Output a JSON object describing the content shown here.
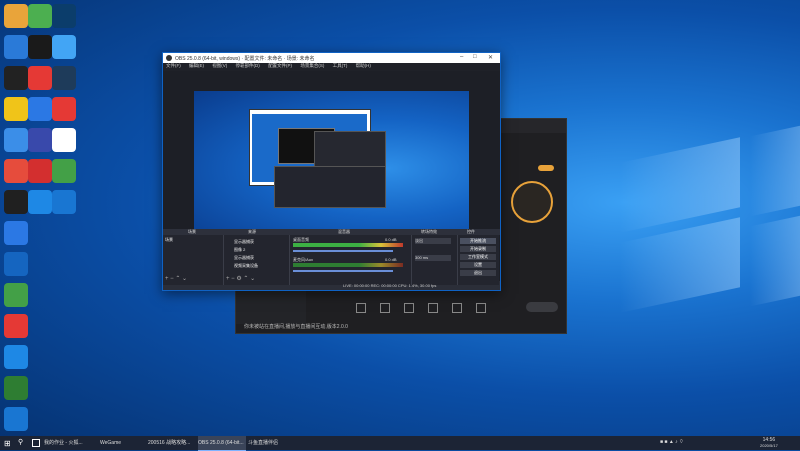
{
  "desktop": {
    "icons": [
      {
        "label": "",
        "color": "#e9a43a"
      },
      {
        "label": "",
        "color": "#2a7ad8"
      },
      {
        "label": "",
        "color": "#222"
      },
      {
        "label": "",
        "color": "#f0c419"
      },
      {
        "label": "",
        "color": "#3b8ee8"
      },
      {
        "label": "",
        "color": "#e64c3c"
      },
      {
        "label": "",
        "color": "#202020"
      },
      {
        "label": "",
        "color": "#4caf50"
      },
      {
        "label": "",
        "color": "#1a1a1a"
      },
      {
        "label": "",
        "color": "#e53935"
      },
      {
        "label": "",
        "color": "#2b78e4"
      },
      {
        "label": "",
        "color": "#3949ab"
      },
      {
        "label": "",
        "color": "#d32f2f"
      },
      {
        "label": "",
        "color": "#1e88e5"
      },
      {
        "label": "",
        "color": "#0b3d6b"
      },
      {
        "label": "",
        "color": "#42a5f5"
      },
      {
        "label": "",
        "color": "#1e3b5a"
      },
      {
        "label": "",
        "color": "#e53935"
      },
      {
        "label": "",
        "color": "#ffffff"
      },
      {
        "label": "",
        "color": "#43a047"
      },
      {
        "label": "",
        "color": "#1976d2"
      }
    ]
  },
  "app2": {
    "footer": "你未被站在直播间,播放与直播间互动,版本2.0.0"
  },
  "obs": {
    "title": "OBS 25.0.8 (64-bit, windows) · 配置文件: 未命名 · 场景: 未命名",
    "menu": [
      "文件(F)",
      "编辑(E)",
      "视图(V)",
      "停靠部件(D)",
      "配置文件(P)",
      "场景集合(S)",
      "工具(T)",
      "帮助(H)"
    ],
    "docks": {
      "scenes": "场景",
      "sources": "来源",
      "mixer": "混音器",
      "transitions": "转场特效",
      "controls": "控件"
    },
    "scene_item": "场景",
    "sources": [
      "显示器捕获",
      "图像 2",
      "显示器捕获",
      "视频采集设备"
    ],
    "mixer_tracks": [
      "桌面音频",
      "麦克风/Aux"
    ],
    "mixer_db": [
      "0.0 dB",
      "0.0 dB"
    ],
    "transition_value": "淡出",
    "transition_duration": "300 ms",
    "controls": [
      "开始推流",
      "开始录制",
      "工作室模式",
      "设置",
      "退出"
    ],
    "status": "LIVE: 00:00:00   REC: 00:00:00   CPU: 1.4%, 30.00 fps"
  },
  "taskbar": {
    "items": [
      "我的作业 - 火狐...",
      "WeGame",
      "200516 战略攻略...",
      "OBS 25.0.8 (64-bit...",
      "斗鱼直播伴侣"
    ],
    "time": "14:56",
    "date": "2020/5/17"
  }
}
